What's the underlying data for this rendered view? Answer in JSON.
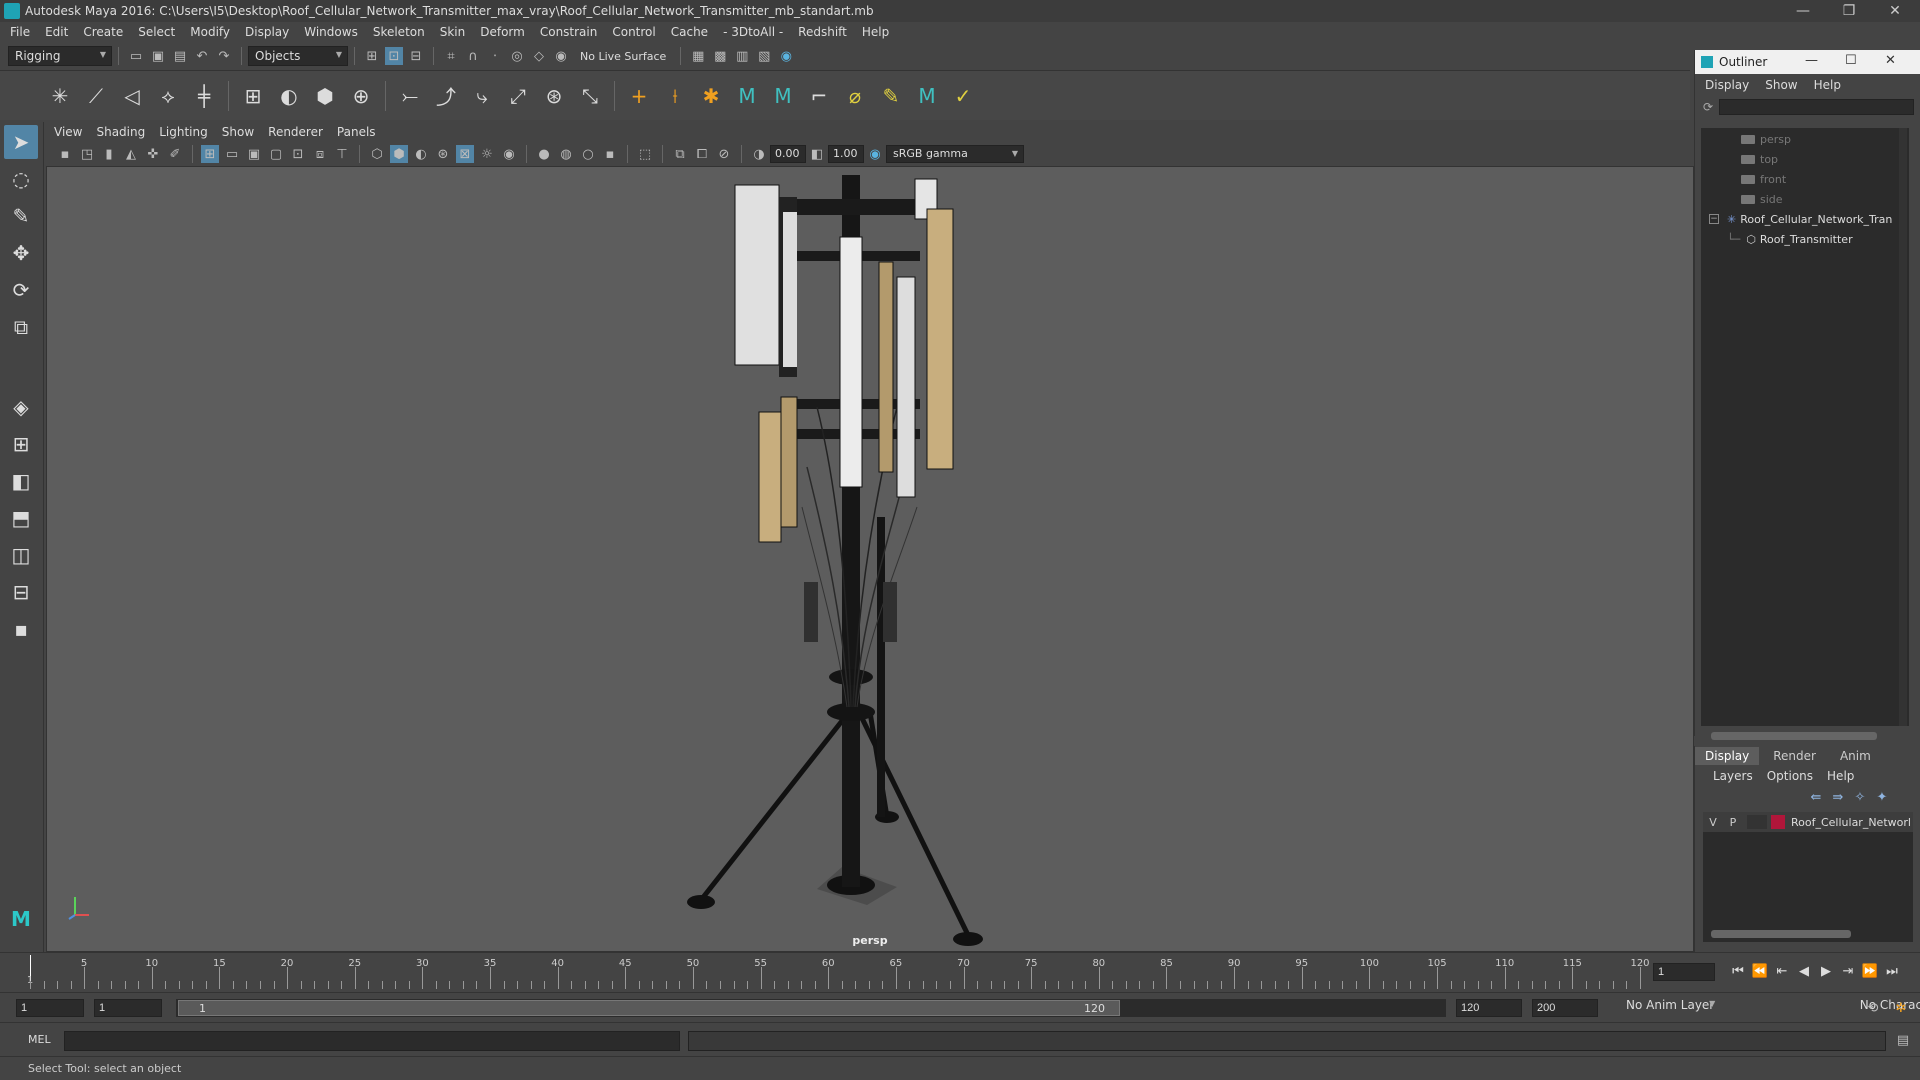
{
  "window": {
    "title": "Autodesk Maya 2016: C:\\Users\\I5\\Desktop\\Roof_Cellular_Network_Transmitter_max_vray\\Roof_Cellular_Network_Transmitter_mb_standart.mb",
    "minimize": "—",
    "maximize": "❐",
    "close": "✕"
  },
  "menubar": [
    "File",
    "Edit",
    "Create",
    "Select",
    "Modify",
    "Display",
    "Windows",
    "Skeleton",
    "Skin",
    "Deform",
    "Constrain",
    "Control",
    "Cache",
    "- 3DtoAll -",
    "Redshift",
    "Help"
  ],
  "statusline": {
    "menuset": "Rigging",
    "selection_mode": "Objects",
    "live_surface": "No Live Surface"
  },
  "panel": {
    "menus": [
      "View",
      "Shading",
      "Lighting",
      "Show",
      "Renderer",
      "Panels"
    ],
    "exposure": "0.00",
    "gamma": "1.00",
    "color_space": "sRGB gamma",
    "camera_label": "persp"
  },
  "outliner": {
    "title": "Outliner",
    "menus": [
      "Display",
      "Show",
      "Help"
    ],
    "items": [
      {
        "label": "persp",
        "kind": "camera"
      },
      {
        "label": "top",
        "kind": "camera"
      },
      {
        "label": "front",
        "kind": "camera"
      },
      {
        "label": "side",
        "kind": "camera"
      },
      {
        "label": "Roof_Cellular_Network_Tran",
        "kind": "group"
      },
      {
        "label": "Roof_Transmitter",
        "kind": "mesh"
      }
    ]
  },
  "layer_editor": {
    "tabs": [
      "Display",
      "Render",
      "Anim"
    ],
    "menus": [
      "Layers",
      "Options",
      "Help"
    ],
    "layer": {
      "v": "V",
      "p": "P",
      "name": "Roof_Cellular_Networl",
      "color": "#b0163a"
    }
  },
  "timeline": {
    "ticks": [
      "5",
      "10",
      "15",
      "20",
      "25",
      "30",
      "35",
      "40",
      "45",
      "50",
      "55",
      "60",
      "65",
      "70",
      "75",
      "80",
      "85",
      "90",
      "95",
      "100",
      "105",
      "110",
      "115",
      "120"
    ],
    "start_label": "1",
    "current_frame": "1"
  },
  "range": {
    "start": "1",
    "playback_start": "1",
    "handle_start": "1",
    "handle_end": "120",
    "playback_end": "120",
    "end": "200",
    "anim_layer": "No Anim Layer",
    "character_set": "No Character Set"
  },
  "cmdline": {
    "lang": "MEL"
  },
  "helpline": "Select Tool: select an object"
}
